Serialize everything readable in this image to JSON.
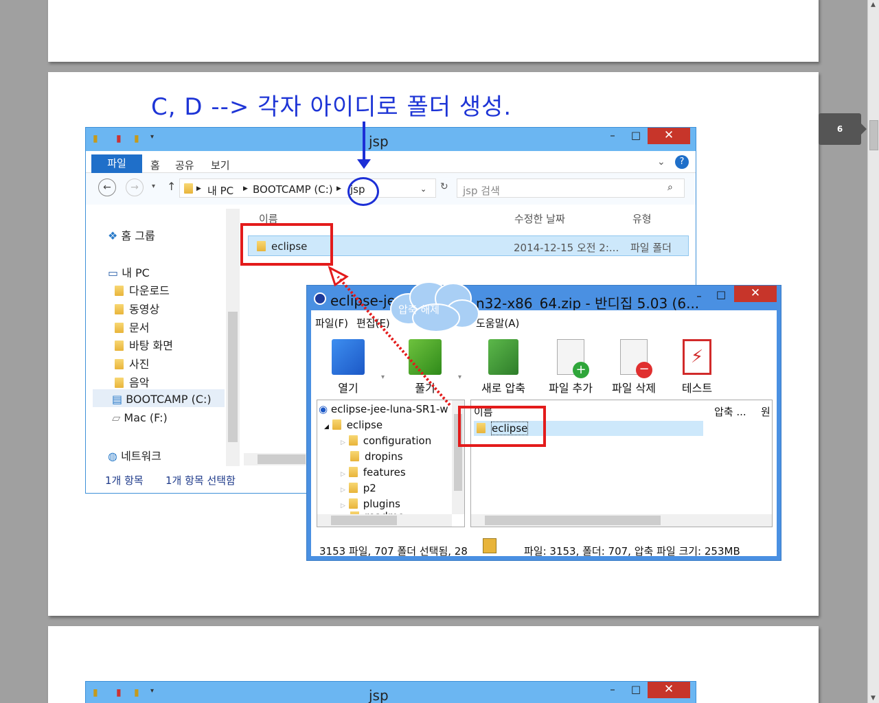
{
  "heading": "C, D --> 각자 아이디로 폴더 생성.",
  "page_number": "6",
  "explorer": {
    "title": "jsp",
    "ribbon_tabs": [
      "파일",
      "홈",
      "공유",
      "보기"
    ],
    "breadcrumb": [
      "내 PC",
      "BOOTCAMP (C:)",
      "jsp"
    ],
    "search_placeholder": "jsp 검색",
    "columns": {
      "name": "이름",
      "modified": "수정한 날짜",
      "type": "유형"
    },
    "rows": [
      {
        "name": "eclipse",
        "modified": "2014-12-15 오전 2:...",
        "type": "파일 폴더"
      }
    ],
    "nav": {
      "homegroup": "홈 그룹",
      "mypc": "내 PC",
      "items": [
        "다운로드",
        "동영상",
        "문서",
        "바탕 화면",
        "사진",
        "음악"
      ],
      "drive_c": "BOOTCAMP (C:)",
      "drive_f": "Mac (F:)",
      "network": "네트워크"
    },
    "status_items": "1개 항목",
    "status_selected": "1개 항목 선택함"
  },
  "explorer2": {
    "title": "jsp"
  },
  "bandizip": {
    "title": "eclipse-jee-luna-SR1-win32-x86_64.zip - 반디집 5.03 (6...",
    "title_start": "eclipse-je",
    "title_end": "n32-x86_64.zip - 반디집 5.03 (6...",
    "menus": [
      "파일(F)",
      "편집(E)",
      "도움말(A)"
    ],
    "tools": [
      "열기",
      "풀기",
      "새로 압축",
      "파일 추가",
      "파일 삭제",
      "테스트"
    ],
    "tree_root": "eclipse-jee-luna-SR1-w",
    "tree": [
      "eclipse",
      "configuration",
      "dropins",
      "features",
      "p2",
      "plugins",
      "readme"
    ],
    "list_columns": {
      "name": "이름",
      "compressed": "압축 ...",
      "original": "원"
    },
    "list_rows": [
      "eclipse"
    ],
    "status_left": "3153 파일, 707 폴더 선택됨, 28",
    "status_right": "파일: 3153, 폴더: 707, 압축 파일 크기: 253MB"
  },
  "callout": "압축 해제",
  "colors": {
    "heading": "#1e35d6",
    "titlebar": "#6bb6f2",
    "highlight": "#e31b1b",
    "selection": "#cde8fb"
  }
}
